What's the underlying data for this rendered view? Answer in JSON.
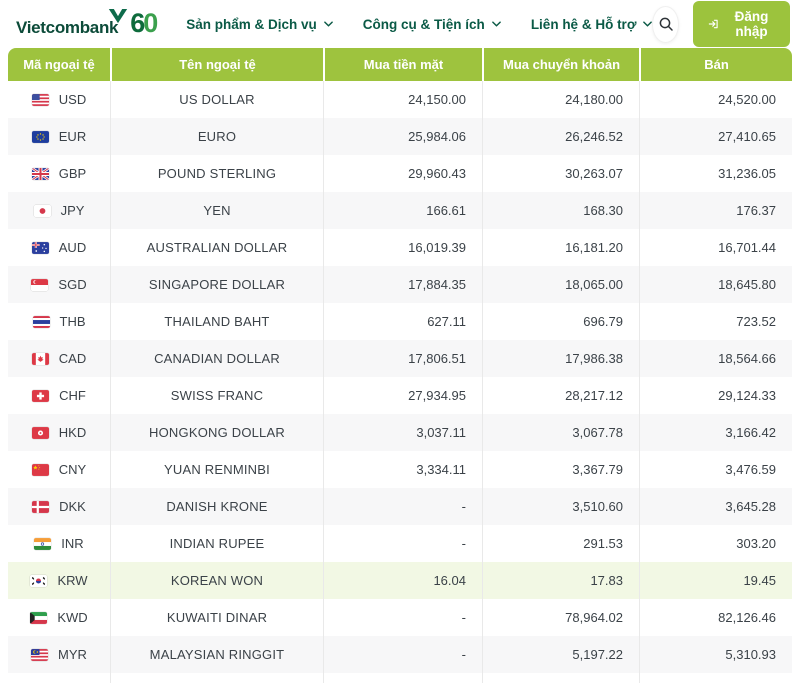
{
  "header": {
    "brand": "Vietcombank",
    "anniversary": "60",
    "nav": [
      {
        "label": "Sản phẩm & Dịch vụ"
      },
      {
        "label": "Công cụ & Tiện ích"
      },
      {
        "label": "Liên hệ & Hỗ trợ"
      }
    ],
    "search_icon": "search-icon",
    "login": {
      "label": "Đăng nhập",
      "icon": "login-icon"
    }
  },
  "table": {
    "columns": [
      "Mã ngoại tệ",
      "Tên ngoại tệ",
      "Mua tiền mặt",
      "Mua chuyển khoản",
      "Bán"
    ],
    "rows": [
      {
        "flag": "usd",
        "code": "USD",
        "name": "US DOLLAR",
        "cash": "24,150.00",
        "transfer": "24,180.00",
        "sell": "24,520.00"
      },
      {
        "flag": "eur",
        "code": "EUR",
        "name": "EURO",
        "cash": "25,984.06",
        "transfer": "26,246.52",
        "sell": "27,410.65"
      },
      {
        "flag": "gbp",
        "code": "GBP",
        "name": "POUND STERLING",
        "cash": "29,960.43",
        "transfer": "30,263.07",
        "sell": "31,236.05"
      },
      {
        "flag": "jpy",
        "code": "JPY",
        "name": "YEN",
        "cash": "166.61",
        "transfer": "168.30",
        "sell": "176.37"
      },
      {
        "flag": "aud",
        "code": "AUD",
        "name": "AUSTRALIAN DOLLAR",
        "cash": "16,019.39",
        "transfer": "16,181.20",
        "sell": "16,701.44"
      },
      {
        "flag": "sgd",
        "code": "SGD",
        "name": "SINGAPORE DOLLAR",
        "cash": "17,884.35",
        "transfer": "18,065.00",
        "sell": "18,645.80"
      },
      {
        "flag": "thb",
        "code": "THB",
        "name": "THAILAND BAHT",
        "cash": "627.11",
        "transfer": "696.79",
        "sell": "723.52"
      },
      {
        "flag": "cad",
        "code": "CAD",
        "name": "CANADIAN DOLLAR",
        "cash": "17,806.51",
        "transfer": "17,986.38",
        "sell": "18,564.66"
      },
      {
        "flag": "chf",
        "code": "CHF",
        "name": "SWISS FRANC",
        "cash": "27,934.95",
        "transfer": "28,217.12",
        "sell": "29,124.33"
      },
      {
        "flag": "hkd",
        "code": "HKD",
        "name": "HONGKONG DOLLAR",
        "cash": "3,037.11",
        "transfer": "3,067.78",
        "sell": "3,166.42"
      },
      {
        "flag": "cny",
        "code": "CNY",
        "name": "YUAN RENMINBI",
        "cash": "3,334.11",
        "transfer": "3,367.79",
        "sell": "3,476.59"
      },
      {
        "flag": "dkk",
        "code": "DKK",
        "name": "DANISH KRONE",
        "cash": "-",
        "transfer": "3,510.60",
        "sell": "3,645.28"
      },
      {
        "flag": "inr",
        "code": "INR",
        "name": "INDIAN RUPEE",
        "cash": "-",
        "transfer": "291.53",
        "sell": "303.20"
      },
      {
        "flag": "krw",
        "code": "KRW",
        "name": "KOREAN WON",
        "cash": "16.04",
        "transfer": "17.83",
        "sell": "19.45",
        "highlight": true
      },
      {
        "flag": "kwd",
        "code": "KWD",
        "name": "KUWAITI DINAR",
        "cash": "-",
        "transfer": "78,964.02",
        "sell": "82,126.46"
      },
      {
        "flag": "myr",
        "code": "MYR",
        "name": "MALAYSIAN RINGGIT",
        "cash": "-",
        "transfer": "5,197.22",
        "sell": "5,310.93"
      }
    ]
  },
  "colors": {
    "accent_lime": "#9ec33e",
    "brand_green": "#0c4b39",
    "nav_green": "#0b5a46",
    "row_alt": "#f7f7f8",
    "row_highlight": "#f2f8e4"
  }
}
